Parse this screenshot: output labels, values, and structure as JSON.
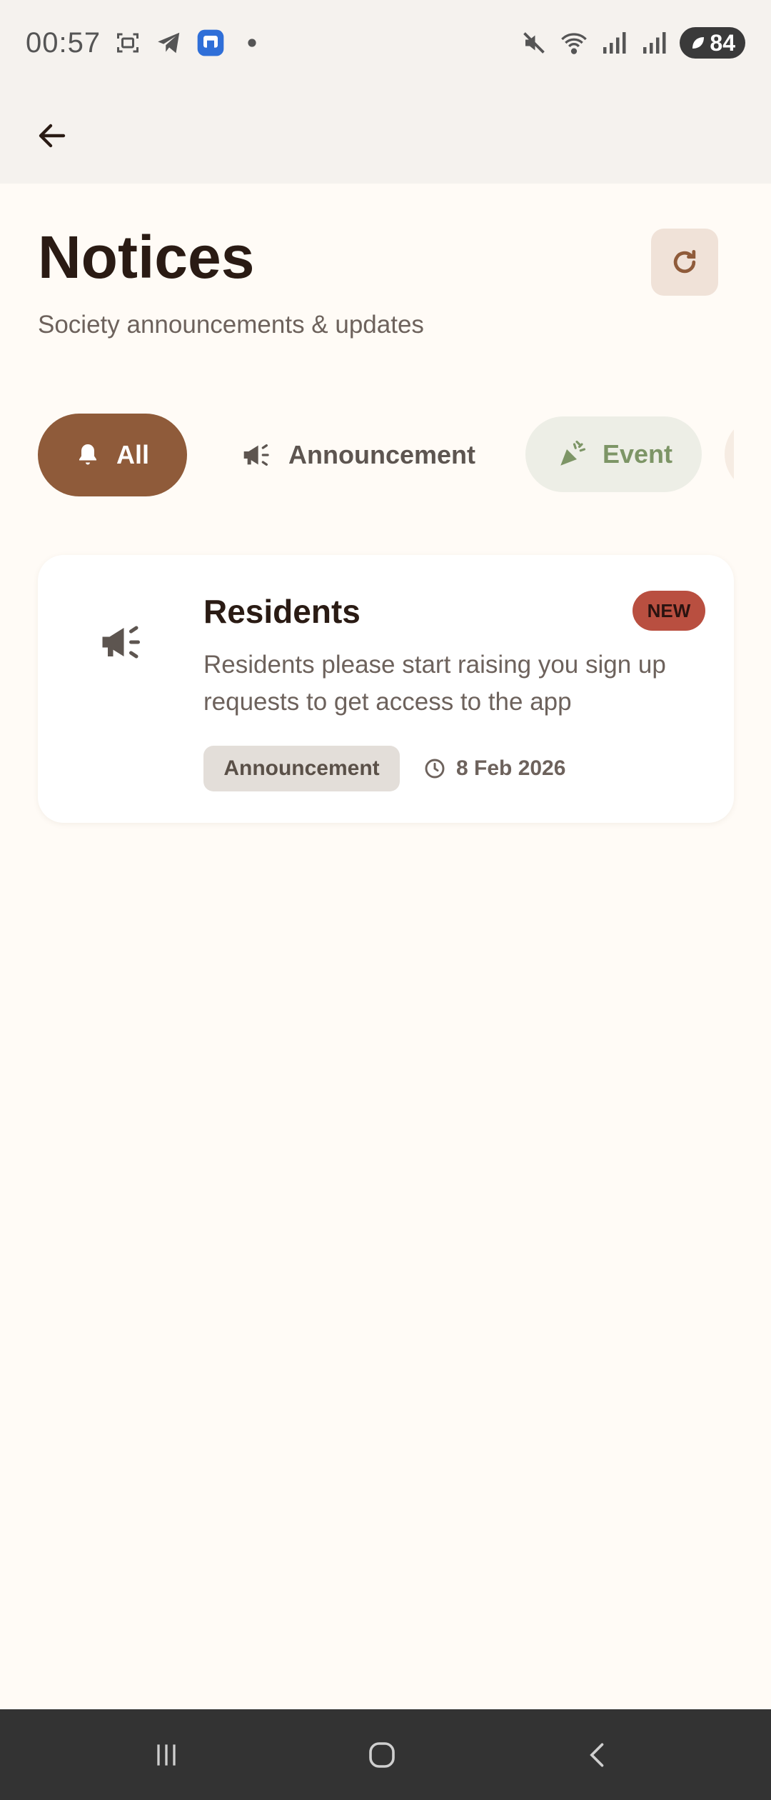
{
  "status_bar": {
    "time": "00:57",
    "battery": "84",
    "left_icons": [
      "screenshot-icon",
      "telegram-icon",
      "app-notification-icon",
      "more-dot-icon"
    ],
    "right_icons": [
      "mute-icon",
      "wifi-icon",
      "signal-icon",
      "signal-icon",
      "battery-icon"
    ]
  },
  "header": {
    "back_icon": "arrow-left-icon"
  },
  "page": {
    "title": "Notices",
    "subtitle": "Society announcements & updates",
    "refresh_icon": "refresh-icon"
  },
  "filters": [
    {
      "label": "All",
      "icon": "bell-icon",
      "selected": true
    },
    {
      "label": "Announcement",
      "icon": "megaphone-icon",
      "selected": false
    },
    {
      "label": "Event",
      "icon": "party-popper-icon",
      "selected": false
    }
  ],
  "notices": [
    {
      "title": "Residents",
      "badge": "NEW",
      "body": "Residents please start raising you sign up requests to get access to the app",
      "category": "Announcement",
      "date": "8 Feb 2026",
      "icon": "megaphone-icon"
    }
  ],
  "nav_bar": {
    "buttons": [
      "recents-icon",
      "home-icon",
      "back-icon"
    ]
  },
  "colors": {
    "accent": "#8f5b3a",
    "background": "#fffbf6",
    "badge_new": "#b94f40",
    "event_chip": "#edeee6",
    "event_text": "#7d9566"
  }
}
